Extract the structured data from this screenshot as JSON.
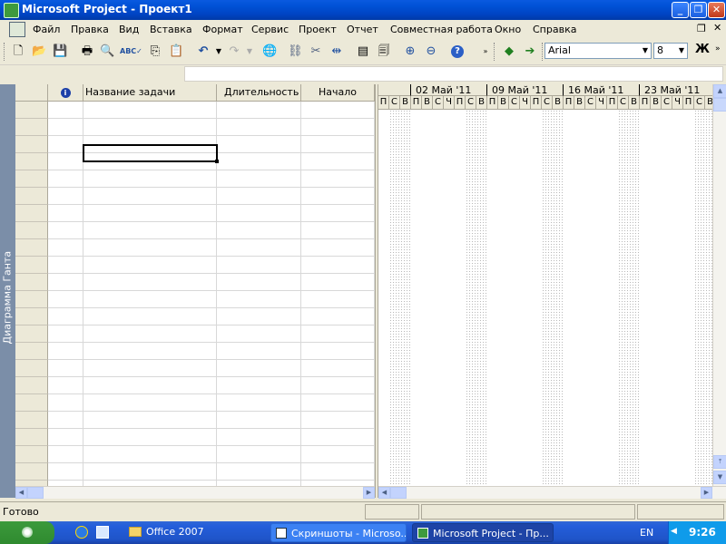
{
  "window": {
    "title": "Microsoft Project - Проект1"
  },
  "menu": [
    "Файл",
    "Правка",
    "Вид",
    "Вставка",
    "Формат",
    "Сервис",
    "Проект",
    "Отчет",
    "Совместная работа",
    "Окно",
    "Справка"
  ],
  "toolbar": {
    "font_name": "Arial",
    "font_size": "8",
    "bold_label": "Ж"
  },
  "view_bar": {
    "label": "Диаграмма Ганта"
  },
  "table": {
    "headers": {
      "info": "i",
      "name": "Название задачи",
      "duration": "Длительность",
      "start": "Начало"
    },
    "row_count": 23
  },
  "gantt": {
    "weeks": [
      "02 Май '11",
      "09 Май '11",
      "16 Май '11",
      "23 Май '11"
    ],
    "days_first": [
      "П",
      "С",
      "В"
    ],
    "days_week": [
      "П",
      "В",
      "С",
      "Ч",
      "П",
      "С",
      "В"
    ]
  },
  "status": {
    "text": "Готово"
  },
  "taskbar": {
    "quick_launch": "Office 2007",
    "tasks": [
      "Скриншоты - Microso...",
      "Microsoft Project - Пр..."
    ],
    "lang": "EN",
    "clock": "9:26"
  },
  "colors": {
    "title_bar": "#0054e3",
    "view_bar": "#7b8ea8",
    "taskbar": "#245edb"
  }
}
